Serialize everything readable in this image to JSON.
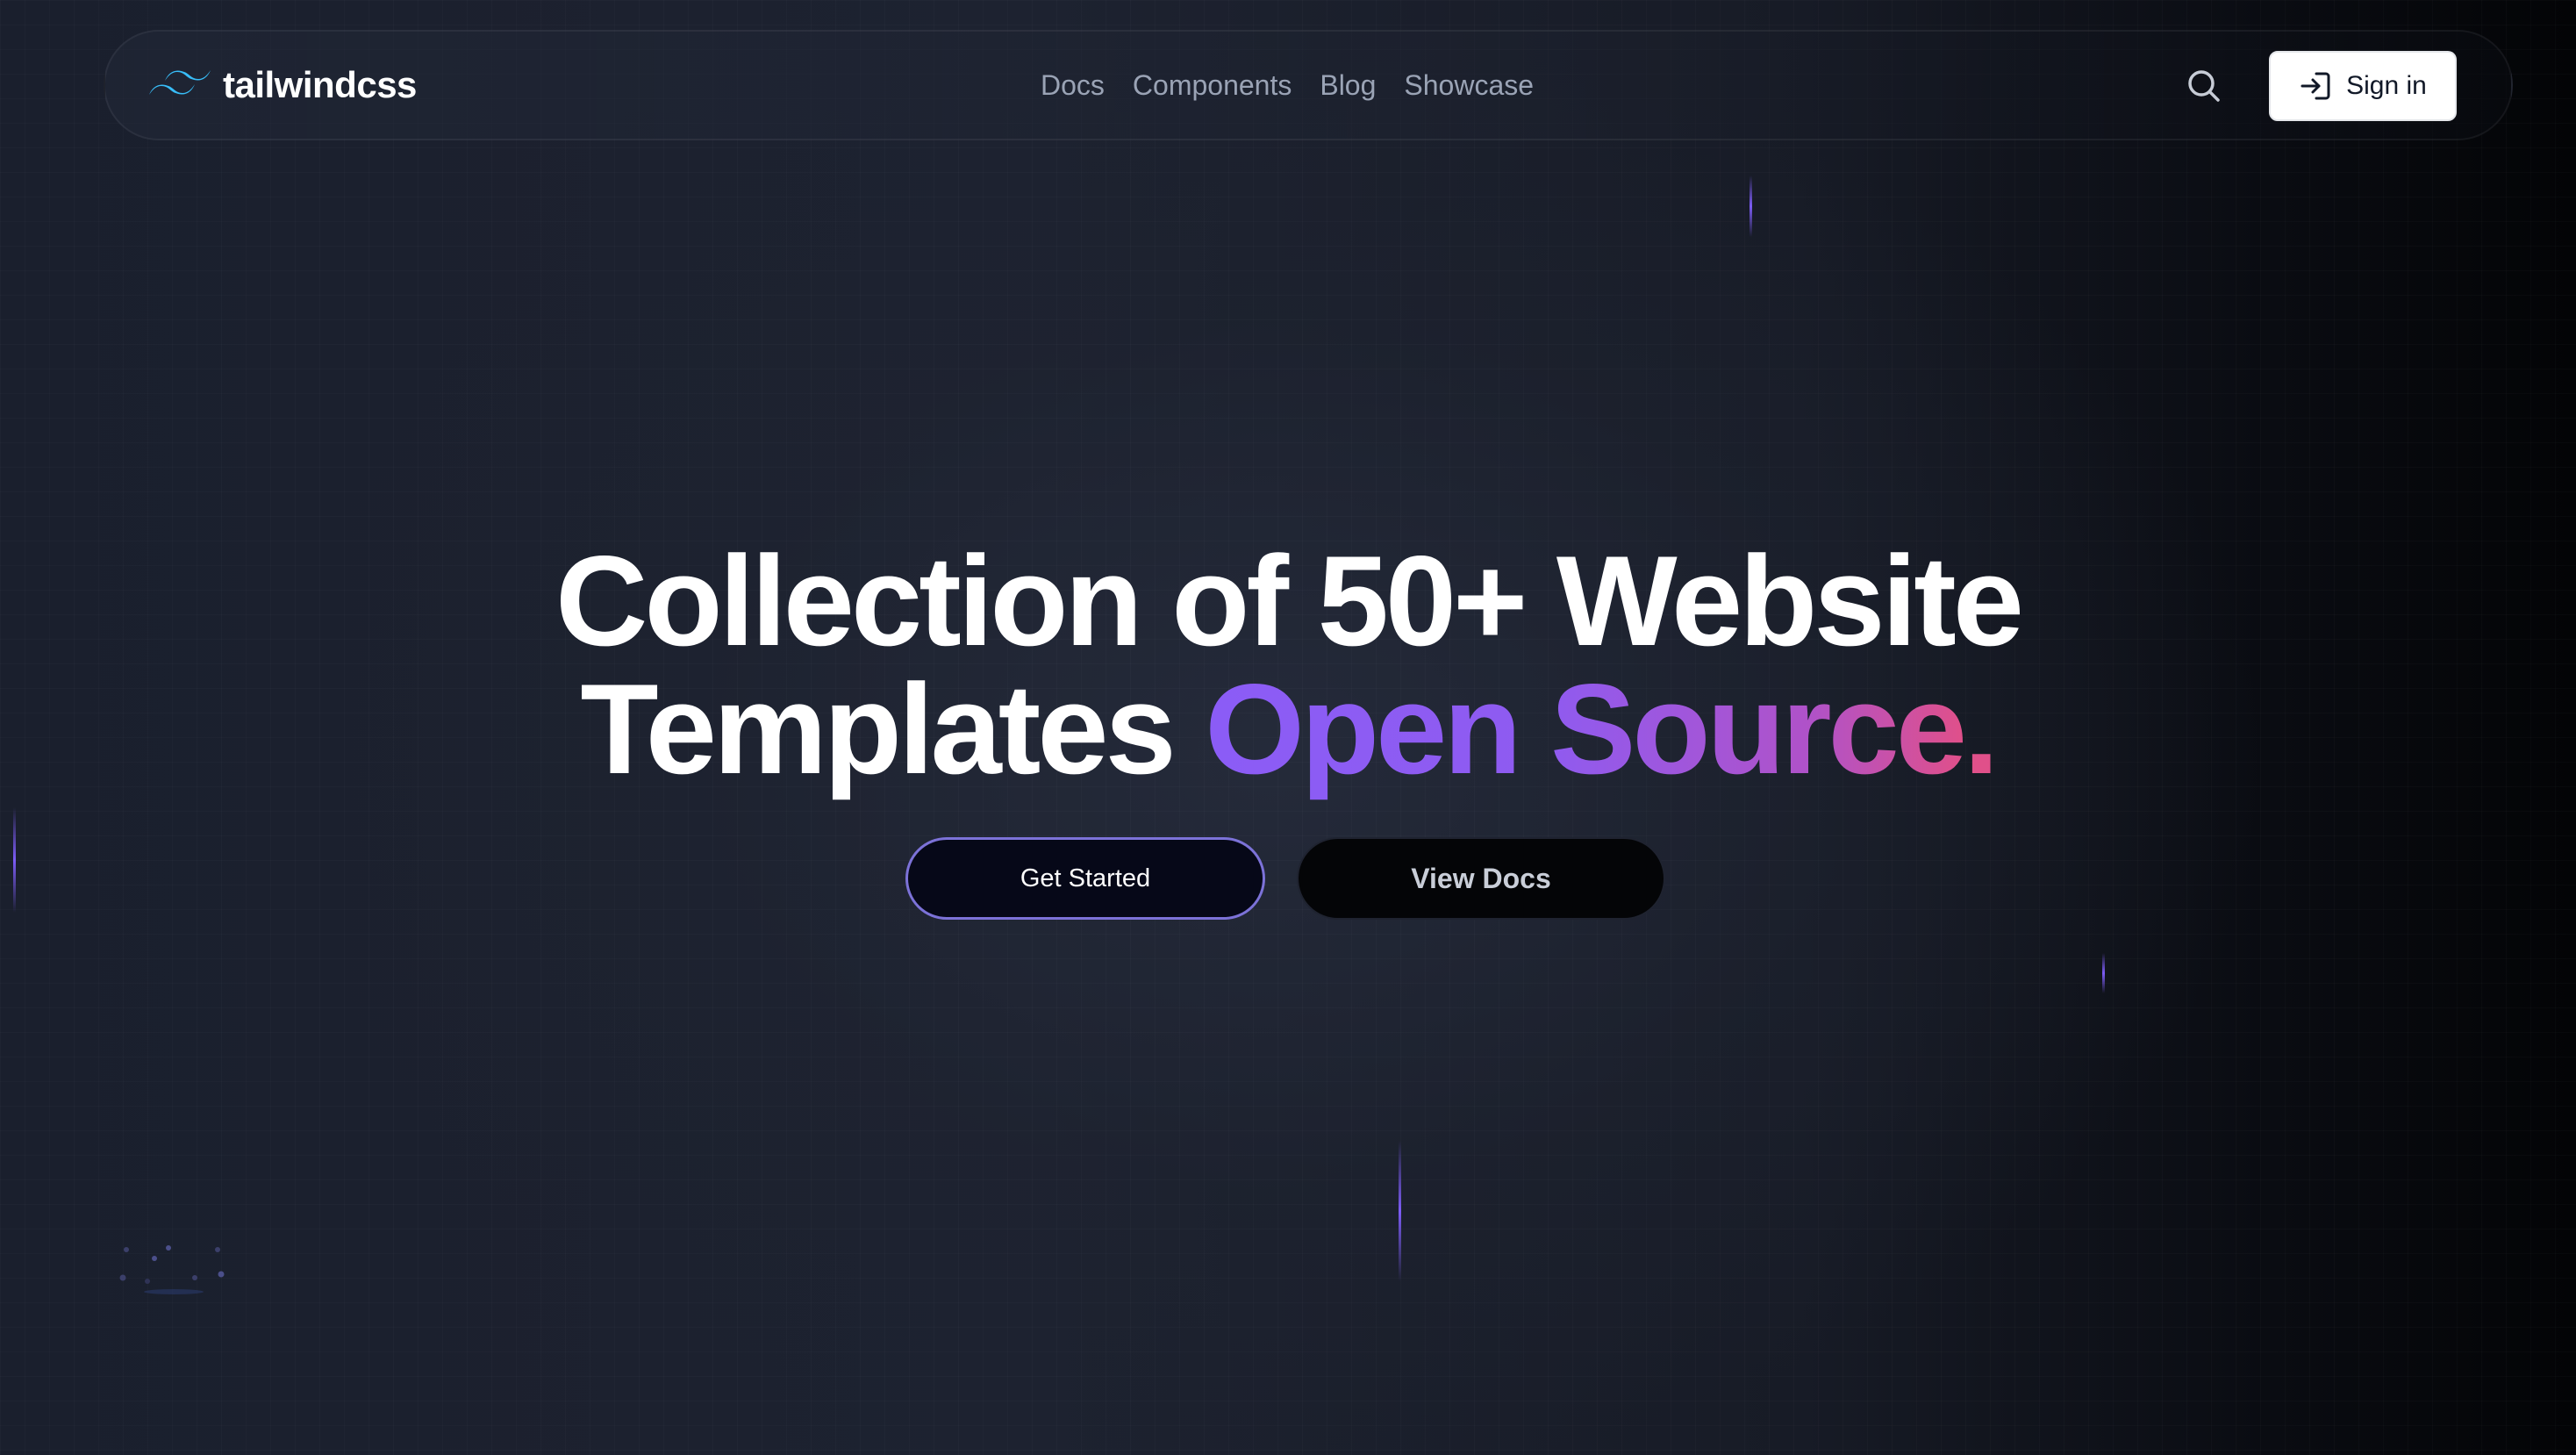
{
  "brand": {
    "name": "tailwindcss",
    "logo_icon": "tailwind-wave-icon",
    "accent_color": "#38bdf8"
  },
  "nav": {
    "links": [
      {
        "label": "Docs"
      },
      {
        "label": "Components"
      },
      {
        "label": "Blog"
      },
      {
        "label": "Showcase"
      }
    ],
    "search_icon": "search-icon",
    "sign_in": {
      "label": "Sign in",
      "icon": "sign-in-icon"
    }
  },
  "hero": {
    "title_line1": "Collection of 50+ Website",
    "title_line2_plain": "Templates",
    "title_line2_gradient": "Open Source",
    "title_line2_dot": ".",
    "gradient_colors": [
      "#8b5cf6",
      "#b052c8",
      "#e0508a"
    ],
    "primary_button": "Get Started",
    "secondary_button": "View Docs"
  },
  "colors": {
    "background": "#1a1f2d",
    "beam": "#7c5cf6",
    "primary_button_border": "#7c72d8"
  }
}
